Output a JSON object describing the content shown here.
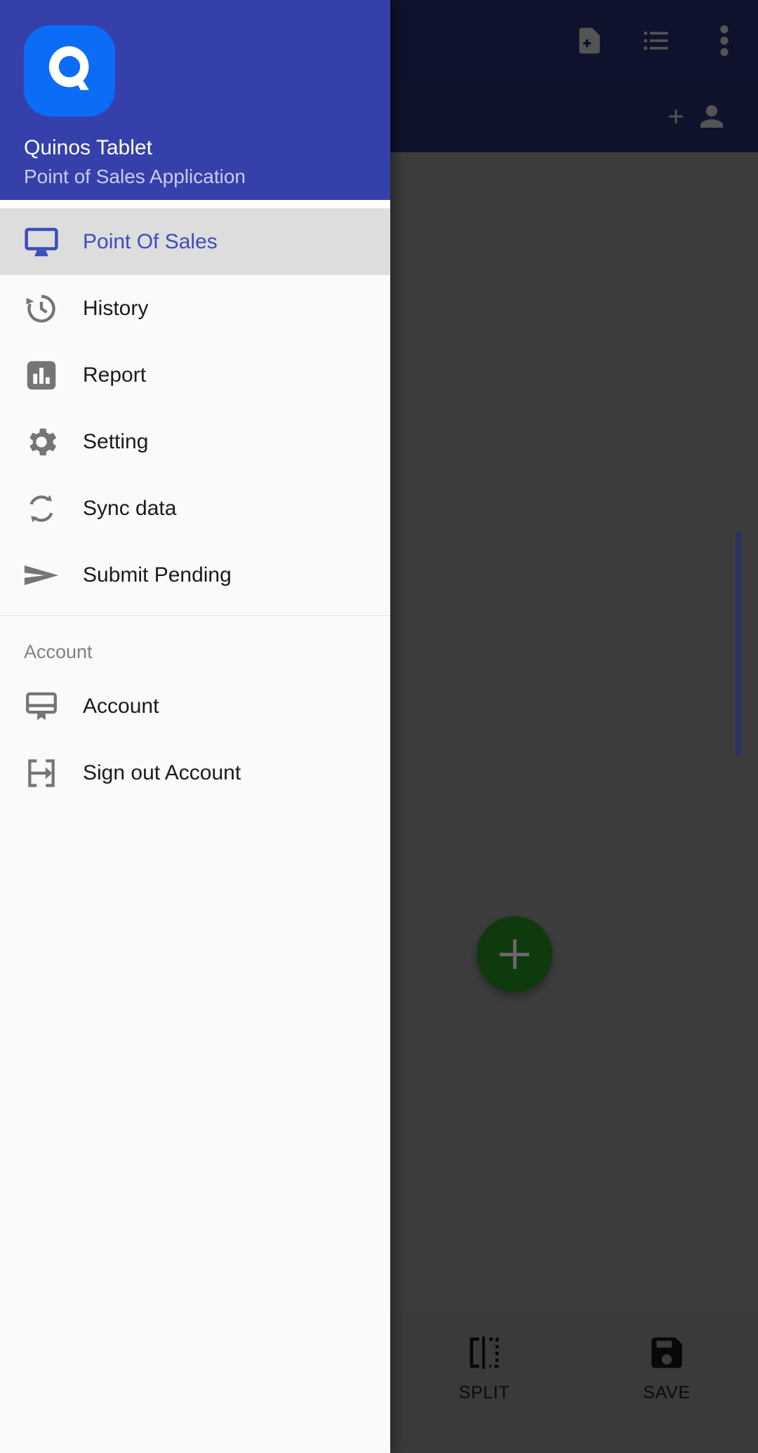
{
  "app": {
    "background_color": "#6e6e6e",
    "appbar_color": "#1c2250",
    "accent_color": "#3640ab",
    "fab_color": "#1b6b1b"
  },
  "appbar": {
    "actions": [
      {
        "name": "note-add-icon",
        "label": "New Note"
      },
      {
        "name": "list-icon",
        "label": "Order List"
      },
      {
        "name": "more-vert-icon",
        "label": "More options"
      }
    ]
  },
  "subbar": {
    "actions": [
      {
        "name": "add-person-icon",
        "label": "Add Customer"
      }
    ]
  },
  "fab": {
    "label": "Add",
    "icon": "plus-icon"
  },
  "bottom_bar": {
    "actions": [
      {
        "label": "SPLIT",
        "icon": "split-icon"
      },
      {
        "label": "SAVE",
        "icon": "save-icon"
      }
    ]
  },
  "drawer": {
    "logo_letter": "Q",
    "title": "Quinos Tablet",
    "subtitle": "Point of Sales Application",
    "items": [
      {
        "label": "Point Of Sales",
        "icon": "monitor-icon",
        "selected": true
      },
      {
        "label": "History",
        "icon": "history-icon",
        "selected": false
      },
      {
        "label": "Report",
        "icon": "bar-chart-icon",
        "selected": false
      },
      {
        "label": "Setting",
        "icon": "gear-icon",
        "selected": false
      },
      {
        "label": "Sync data",
        "icon": "sync-icon",
        "selected": false
      },
      {
        "label": "Submit Pending",
        "icon": "send-icon",
        "selected": false
      }
    ],
    "account_section": {
      "title": "Account",
      "items": [
        {
          "label": "Account",
          "icon": "account-card-icon",
          "selected": false
        },
        {
          "label": "Sign out Account",
          "icon": "logout-icon",
          "selected": false
        }
      ]
    }
  }
}
